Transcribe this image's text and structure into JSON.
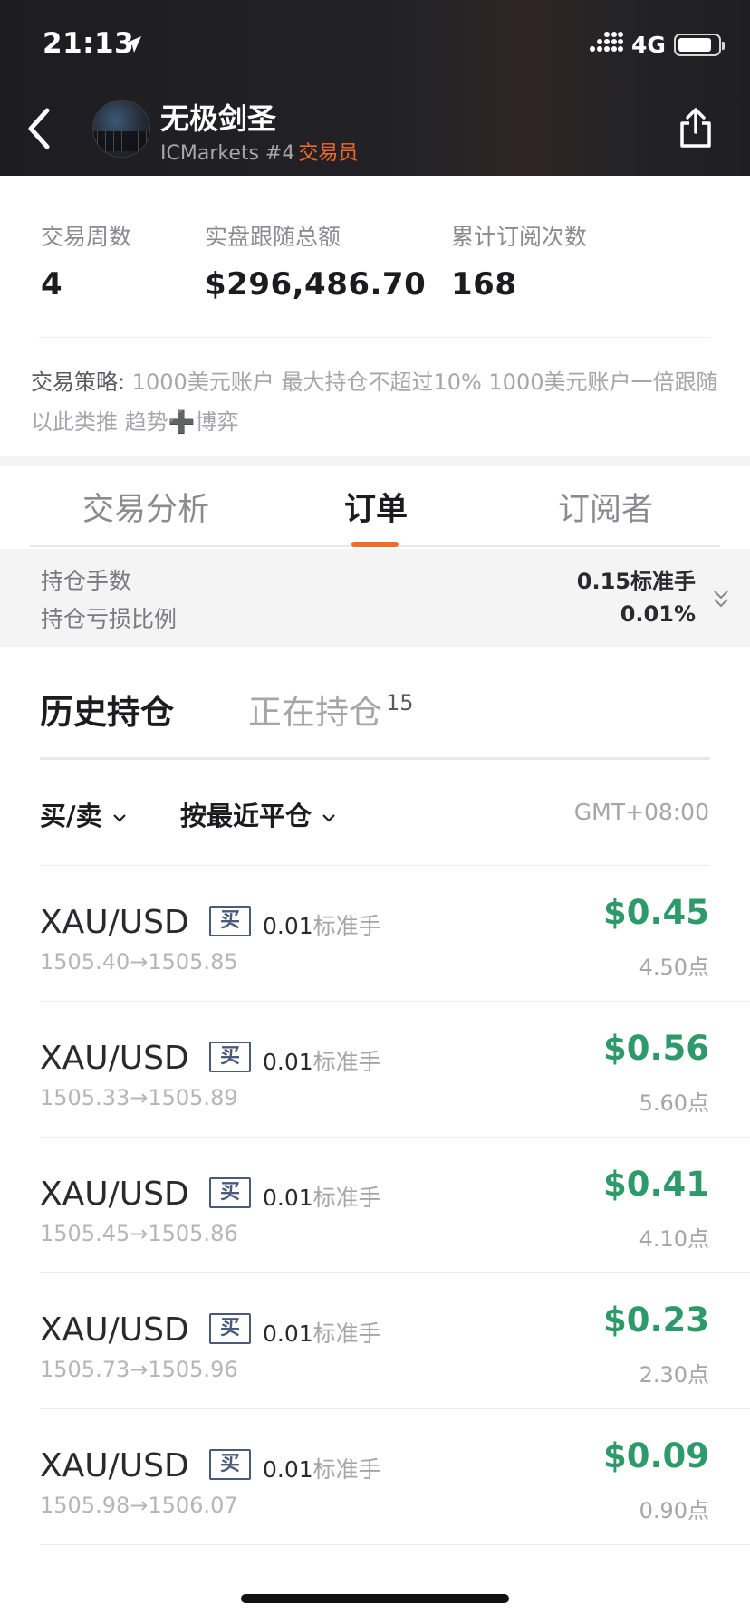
{
  "status_bar": {
    "time": "21:13",
    "network": "4G",
    "battery_level": 0.85
  },
  "header": {
    "trader_name": "无极剑圣",
    "broker": "ICMarkets #4",
    "role": "交易员"
  },
  "stats": {
    "items": [
      {
        "label": "交易周数",
        "value": "4"
      },
      {
        "label": "实盘跟随总额",
        "value": "$296,486.70"
      },
      {
        "label": "累计订阅次数",
        "value": "168"
      }
    ],
    "strategy_label": "交易策略:",
    "strategy_text": "1000美元账户  最大持仓不超过10%  1000美元账户一倍跟随  以此类推  趋势➕博弈"
  },
  "tabs": [
    {
      "label": "交易分析",
      "active": false
    },
    {
      "label": "订单",
      "active": true
    },
    {
      "label": "订阅者",
      "active": false
    }
  ],
  "summary": {
    "lots_label": "持仓手数",
    "lots_value": "0.15标准手",
    "pl_label": "持仓亏损比例",
    "pl_value": "0.01%"
  },
  "subtabs": {
    "history": "历史持仓",
    "open": "正在持仓",
    "open_count": "15"
  },
  "filters": {
    "side": "买/卖",
    "sort": "按最近平仓",
    "timezone": "GMT+08:00"
  },
  "orders": [
    {
      "symbol": "XAU/USD",
      "side": "买",
      "lots": "0.01",
      "lots_unit": "标准手",
      "prices": "1505.40→1505.85",
      "profit": "$0.45",
      "points": "4.50点"
    },
    {
      "symbol": "XAU/USD",
      "side": "买",
      "lots": "0.01",
      "lots_unit": "标准手",
      "prices": "1505.33→1505.89",
      "profit": "$0.56",
      "points": "5.60点"
    },
    {
      "symbol": "XAU/USD",
      "side": "买",
      "lots": "0.01",
      "lots_unit": "标准手",
      "prices": "1505.45→1505.86",
      "profit": "$0.41",
      "points": "4.10点"
    },
    {
      "symbol": "XAU/USD",
      "side": "买",
      "lots": "0.01",
      "lots_unit": "标准手",
      "prices": "1505.73→1505.96",
      "profit": "$0.23",
      "points": "2.30点"
    },
    {
      "symbol": "XAU/USD",
      "side": "买",
      "lots": "0.01",
      "lots_unit": "标准手",
      "prices": "1505.98→1506.07",
      "profit": "$0.09",
      "points": "0.90点"
    }
  ],
  "colors": {
    "accent": "#f06a2a",
    "profit": "#2e9a6a",
    "badge": "#4a5a7a"
  }
}
